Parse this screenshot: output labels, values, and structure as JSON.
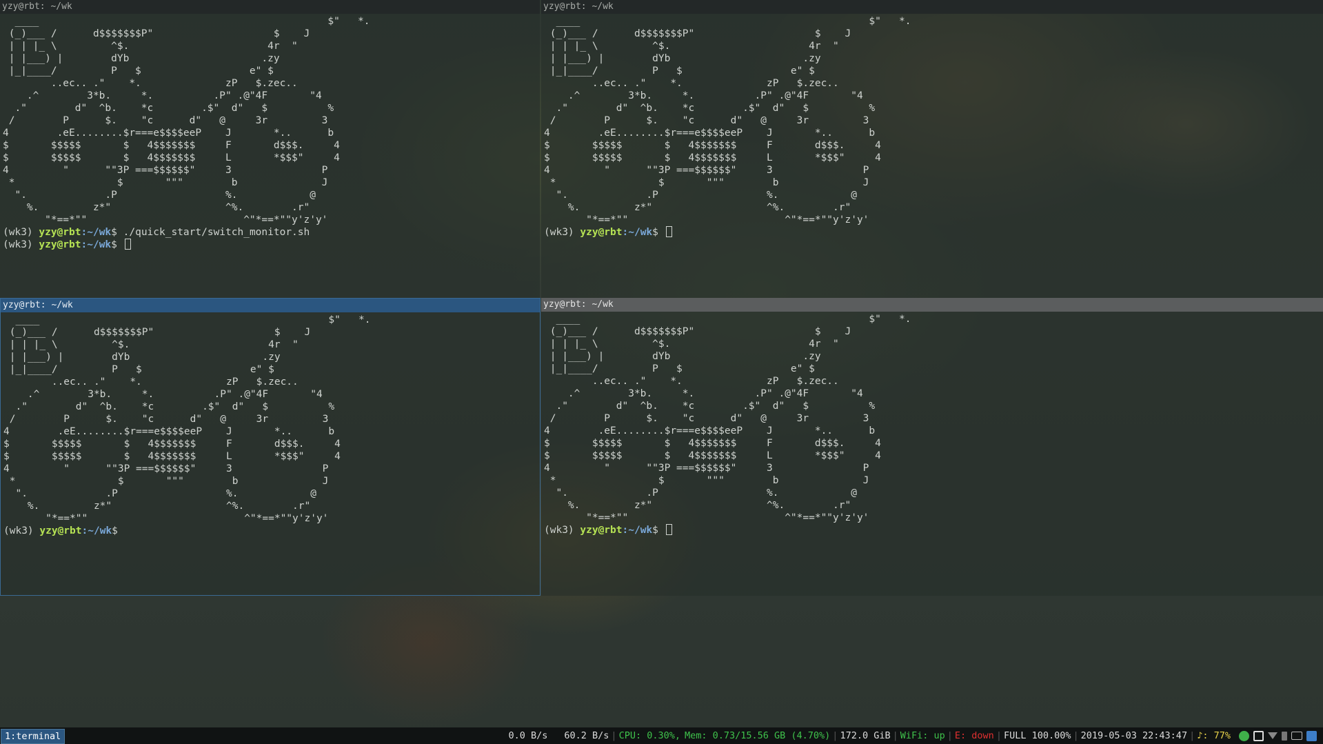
{
  "neofetch_art": "  ____                                                $\"   *.\n (_)___ /      d$$$$$$$P\"                    $    J\n | | |_ \\         ^$.                       4r  \"\n | |___) |        dYb                      .zy\n |_|____/         P   $                  e\" $\n        ..ec.. .\"    *.              zP   $.zec..\n    .^        3*b.     *.          .P\" .@\"4F       \"4\n  .\"        d\"  ^b.    *c        .$\"  d\"   $          %\n /        P      $.    \"c      d\"   @     3r         3\n4        .eE........$r===e$$$$eeP    J       *..      b\n$       $$$$$       $   4$$$$$$$     F       d$$$.     4\n$       $$$$$       $   4$$$$$$$     L       *$$$\"     4\n4         \"      \"\"3P ===$$$$$$\"     3               P\n *                 $       \"\"\"        b              J\n  \".             .P                  %.            @\n    %.         z*\"                   ^%.        .r\"\n       \"*==*\"\"                          ^\"*==*\"\"y'z'y'",
  "panes": [
    {
      "title": "yzy@rbt: ~/wk",
      "lines": [
        {
          "env": "(wk3) ",
          "user": "yzy@rbt",
          "path": ":~/wk",
          "sym": "$ ",
          "cmd": "./quick_start/switch_monitor.sh",
          "cursor": false
        },
        {
          "env": "(wk3) ",
          "user": "yzy@rbt",
          "path": ":~/wk",
          "sym": "$ ",
          "cmd": "",
          "cursor": true
        }
      ]
    },
    {
      "title": "yzy@rbt: ~/wk",
      "lines": [
        {
          "env": "(wk3) ",
          "user": "yzy@rbt",
          "path": ":~/wk",
          "sym": "$ ",
          "cmd": "",
          "cursor": true
        }
      ]
    },
    {
      "title": "yzy@rbt: ~/wk",
      "lines": [
        {
          "env": "(wk3) ",
          "user": "yzy@rbt",
          "path": ":~/wk",
          "sym": "$",
          "cmd": "",
          "cursor": false
        }
      ]
    },
    {
      "title": "yzy@rbt: ~/wk",
      "lines": [
        {
          "env": "(wk3) ",
          "user": "yzy@rbt",
          "path": ":~/wk",
          "sym": "$ ",
          "cmd": "",
          "cursor": true
        }
      ]
    }
  ],
  "taskbar": {
    "workspace": "1:terminal",
    "net_up": "0.0 B/s",
    "net_down": "60.2 B/s",
    "cpu": "CPU: 0.30%,",
    "mem": "Mem: 0.73/15.56 GB (4.70%)",
    "disk": "172.0 GiB",
    "wifi": "WiFi: up",
    "ethernet": "E: down",
    "battery": "FULL 100.00%",
    "datetime": "2019-05-03 22:43:47",
    "volume": "♪: 77%"
  },
  "tray_icons": [
    "telegram-icon",
    "scissors-icon",
    "network-icon",
    "battery-icon",
    "keyboard-icon",
    "update-icon"
  ],
  "colors": {
    "focused_border": "#3a6a94",
    "prompt_user": "#b6e354",
    "prompt_path": "#7aa8d8",
    "status_green": "#3fc24b",
    "status_red": "#e03030"
  }
}
